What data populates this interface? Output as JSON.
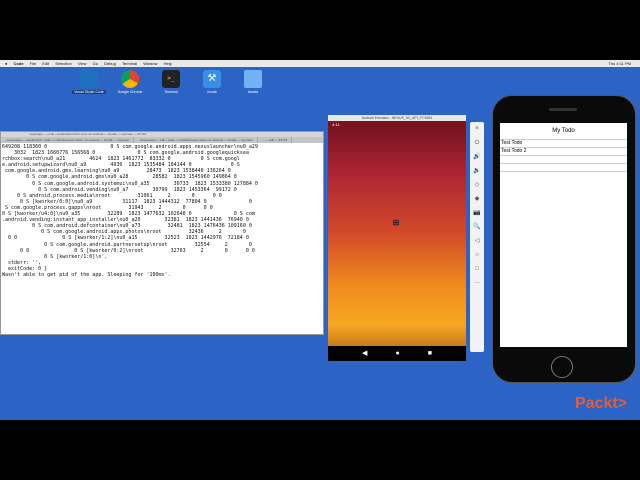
{
  "menubar": {
    "items": [
      "Code",
      "File",
      "Edit",
      "Selection",
      "View",
      "Go",
      "Debug",
      "Terminal",
      "Window",
      "Help"
    ],
    "clock": "Thu 4:11 PM"
  },
  "desktop": {
    "icons": [
      {
        "label": "Visual Studio Code",
        "color": "#1f6fbf"
      },
      {
        "label": "Google Chrome",
        "color": "#e8e8e8"
      },
      {
        "label": "Terminal",
        "color": "#222222"
      },
      {
        "label": "Xcode",
        "color": "#3a8ee6"
      },
      {
        "label": "Assets",
        "color": "#6fb3f2"
      }
    ]
  },
  "terminal": {
    "title": "mytestapp — node  ~/nodenode/.bin/rn-cli.js run-android — bundle — log:trace — 87×23",
    "tabs": [
      "~/mytestapp — sandbox/bit • node ~/.node/bin/react-native run-android — bundle — log:trace",
      "~/mytestapp — adb • node ~/.node/bin/react-native run-android — bundle — log:trace",
      "~ — adb — 87×23"
    ],
    "lines": [
      "649208 118360 0                     0 S com.google.android.apps.nexuslauncher\\nu0_a29",
      "    3032  1823 1660776 156568 0              0 S com.google.android.googlequicksea",
      "rchbox:search\\nu0_a21        4624  1823 1461772  83332 0          0 S com.googl",
      "e.android.setupwizard\\nu0_a9        4936  1823 1535484 104144 0             0 S",
      " com.google.android.gms.learning\\nu0_a9         28473  1823 1538440 136264 0",
      "        0 S com.google.android.gms\\nu0_a28        28582  1823 1545960 149864 0",
      "          0 S com.google.android.systemui\\nu0_a35        30733  1823 1533380 127884 0",
      "            0 S com.android.vending\\nu0_a7        30799  1823 1453364  99172 0",
      "     0 S android.process.media\\nroot         31061     2       0      0 0",
      "      0 S [kworker/0:0]\\nu0_a9          31117  1823 1444312  77804 0              0",
      " S com.google.process.gapps\\nroot         31943     2       0      0 0",
      "0 S [kworker/u4:0]\\nu0_a35         32289  1823 1477632 102648 0              0 S com",
      ".android.vending:instant_app_installer\\nu0_a20        32381  1823 1441436  76940 0",
      "          0 S com.android.defcontainer\\nu0_a73         32481  1823 1476436 109160 0",
      "             0 S com.google.android.apps.photos\\nroot         32436     2       0",
      "  0 0               0 S [kworker/1:2]\\nu0_a15         32523  1823 1442976  72184 0",
      "              0 S com.google.android.partnersetup\\nroot         32554     2       0",
      "      0 0               0 S [kworker/0:2]\\nroot         32763     2       0      0 0",
      "              0 S [kworker/1:0]\\n',",
      "  stderr: '',",
      "  exitCode: 0 }",
      "Wasn't able to get pid of the app. Sleeping for '100ms'."
    ]
  },
  "emulator": {
    "title": "Android Emulator - NEXUS_5X_API_27:5554",
    "time": "4:11",
    "nav": [
      "◀",
      "●",
      "■"
    ]
  },
  "emulator_toolbar": {
    "icons": [
      "×",
      "⏻",
      "🔊",
      "🔉",
      "◇",
      "◆",
      "📷",
      "🔍",
      "◁",
      "○",
      "□",
      "···"
    ]
  },
  "phone": {
    "title": "My Todo",
    "items": [
      "Test Todo",
      "Test Todo 2"
    ]
  },
  "brand": {
    "text": "Packt>"
  }
}
